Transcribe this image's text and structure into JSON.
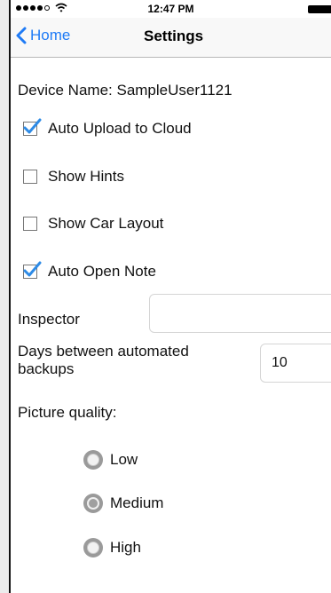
{
  "status_bar": {
    "time": "12:47 PM"
  },
  "nav": {
    "back_label": "Home",
    "title": "Settings"
  },
  "settings": {
    "device_name": "Device Name: SampleUser1121",
    "checkboxes": [
      {
        "label": "Auto Upload to Cloud",
        "checked": true
      },
      {
        "label": "Show Hints",
        "checked": false
      },
      {
        "label": "Show Car Layout",
        "checked": false
      },
      {
        "label": "Auto Open Note",
        "checked": true
      }
    ],
    "inspector": {
      "label": "Inspector",
      "value": ""
    },
    "backups": {
      "label": "Days between automated backups",
      "value": "10"
    },
    "picture_quality": {
      "label": "Picture quality:",
      "options": [
        {
          "label": "Low",
          "selected": false
        },
        {
          "label": "Medium",
          "selected": true
        },
        {
          "label": "High",
          "selected": false
        }
      ]
    }
  },
  "colors": {
    "accent": "#1f7bf6",
    "check": "#2e8be6"
  }
}
